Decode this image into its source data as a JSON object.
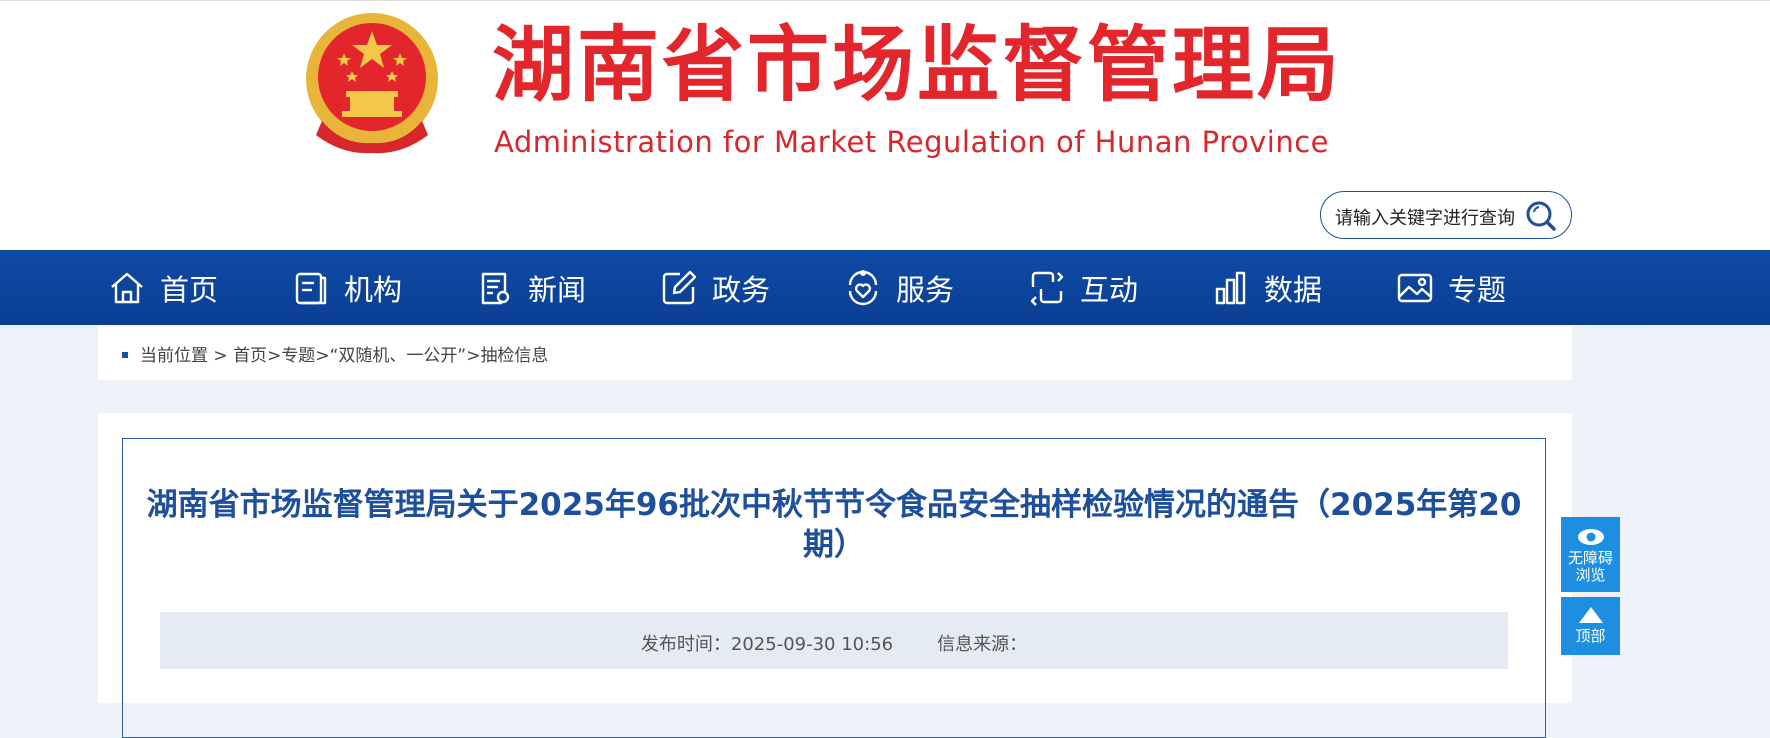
{
  "header": {
    "title": "湖南省市场监督管理局",
    "subtitle": "Administration for Market Regulation of Hunan Province",
    "emblem_icon": "national-emblem-icon"
  },
  "search": {
    "placeholder": "请输入关键字进行查询",
    "icon": "search-icon"
  },
  "nav": {
    "items": [
      {
        "label": "首页",
        "icon": "home-icon"
      },
      {
        "label": "机构",
        "icon": "organization-icon"
      },
      {
        "label": "新闻",
        "icon": "news-icon"
      },
      {
        "label": "政务",
        "icon": "edit-icon"
      },
      {
        "label": "服务",
        "icon": "service-icon"
      },
      {
        "label": "互动",
        "icon": "interaction-icon"
      },
      {
        "label": "数据",
        "icon": "data-chart-icon"
      },
      {
        "label": "专题",
        "icon": "image-icon"
      }
    ]
  },
  "breadcrumb": {
    "prefix": "当前位置 > ",
    "home": "首页",
    "sep1": ">",
    "topic": "专题",
    "sep2": ">",
    "section": "“双随机、一公开”",
    "sep3": ">",
    "current": "抽检信息"
  },
  "article": {
    "title": "湖南省市场监督管理局关于2025年96批次中秋节节令食品安全抽样检验情况的通告（2025年第20期）",
    "publish_label": "发布时间：",
    "publish_time": "2025-09-30 10:56",
    "source_label": "信息来源："
  },
  "floating": {
    "accessibility_line1": "无障碍",
    "accessibility_line2": "浏览",
    "top_label": "顶部"
  },
  "colors": {
    "nav_blue": "#0d4aa5",
    "title_red": "#e3262b",
    "article_title_blue": "#1d4f9c",
    "float_blue": "#1e8fe0",
    "page_bg": "#eff3f9"
  }
}
